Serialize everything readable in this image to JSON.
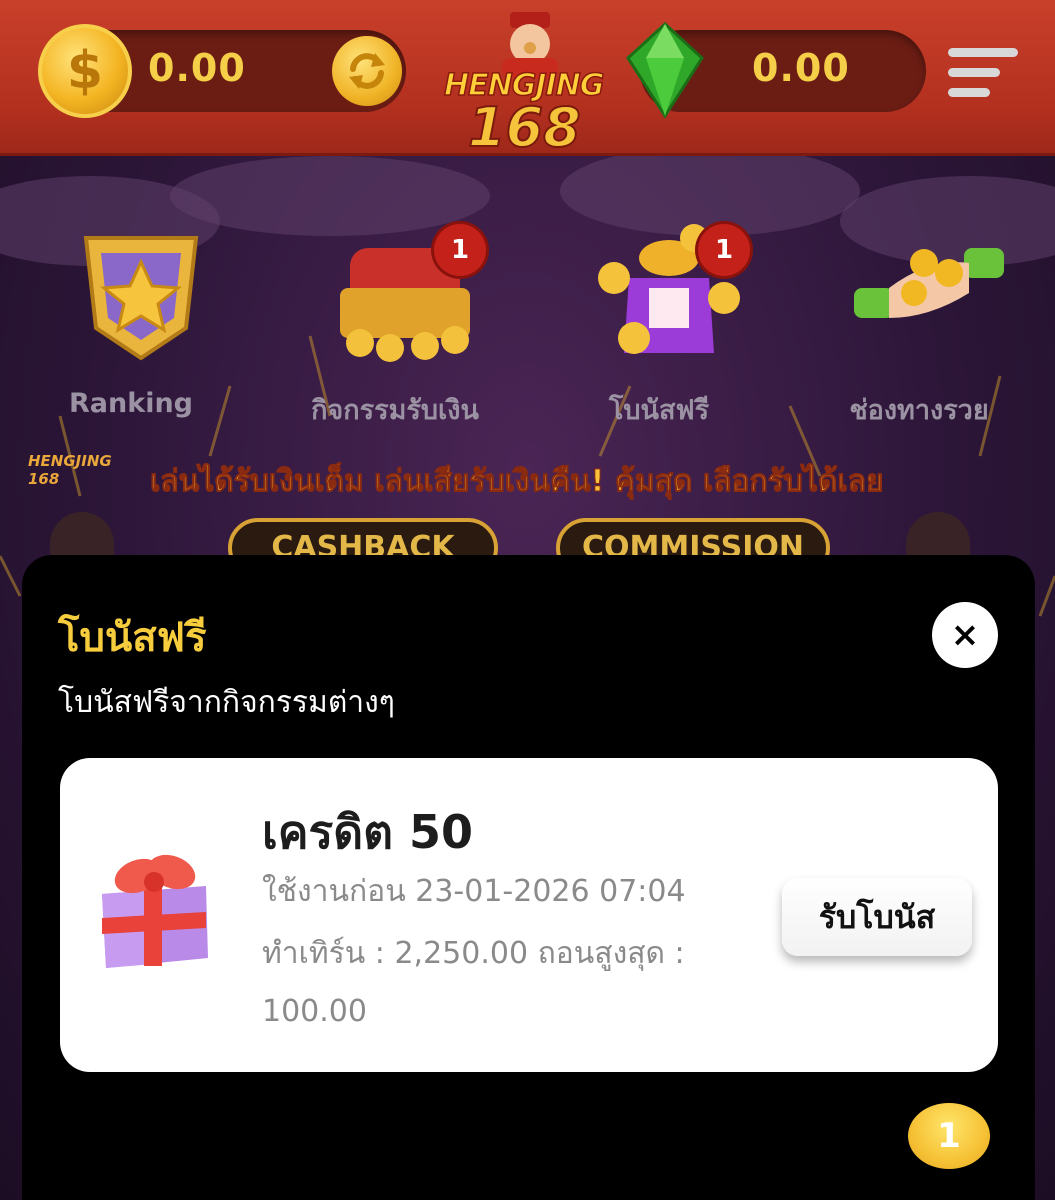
{
  "header": {
    "money_balance": "0.00",
    "gem_balance": "0.00",
    "logo_text": "HENGJING",
    "logo_number": "168",
    "icons": {
      "coin": "dollar-coin-icon",
      "refresh": "refresh-icon",
      "gem": "green-gem-icon",
      "menu": "hamburger-menu-icon"
    },
    "coin_symbol": "$"
  },
  "menu": {
    "items": [
      {
        "label": "Ranking",
        "icon": "star-trophy-icon"
      },
      {
        "label": "กิจกรรมรับเงิน",
        "icon": "treasure-chest-icon",
        "badge": "1"
      },
      {
        "label": "โบนัสฟรี",
        "icon": "gift-box-coins-icon",
        "badge": "1"
      },
      {
        "label": "ช่องทางรวย",
        "icon": "hand-coins-icon"
      }
    ]
  },
  "promo": {
    "headline": "เล่นได้รับเงินเต็ม เล่นเสียรับเงินคืน! คุ้มสุด เลือกรับได้เลย",
    "small_logo": "HENGJING 168",
    "buttons": [
      "CASHBACK",
      "COMMISSION"
    ]
  },
  "dialog": {
    "title": "โบนัสฟรี",
    "subtitle": "โบนัสฟรีจากกิจกรรมต่างๆ",
    "close_symbol": "×",
    "bonus": {
      "title": "เครดิต 50",
      "expiry": "ใช้งานก่อน 23-01-2026 07:04",
      "turnover": "ทำเทิร์น : 2,250.00 ถอนสูงสุด :",
      "max_withdraw": "100.00",
      "claim_label": "รับโบนัส",
      "icon": "gift-box-icon"
    },
    "page_indicator": "1"
  },
  "colors": {
    "header_red": "#c9402a",
    "gold": "#f5cf48",
    "dialog_bg": "#000000",
    "title_yellow": "#f7cd3e",
    "badge_red": "#c4211a"
  }
}
